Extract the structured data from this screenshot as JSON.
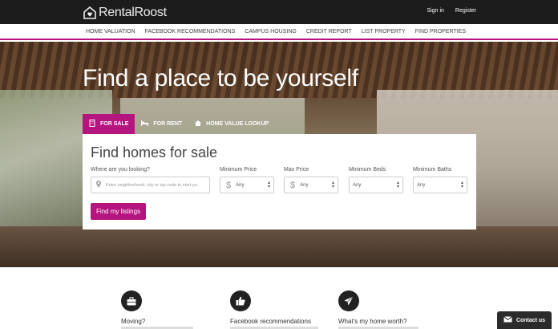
{
  "brand": {
    "name": "RentalRoost"
  },
  "header": {
    "links": [
      "Sign in",
      "Register"
    ]
  },
  "nav": {
    "items": [
      "HOME VALUATION",
      "FACEBOOK RECOMMENDATIONS",
      "CAMPUS HOUSING",
      "CREDIT REPORT",
      "LIST PROPERTY",
      "FIND PROPERTIES"
    ]
  },
  "hero": {
    "title": "Find a place to be yourself"
  },
  "tabs": [
    {
      "label": "FOR SALE",
      "icon": "building-icon"
    },
    {
      "label": "FOR RENT",
      "icon": "bed-icon"
    },
    {
      "label": "HOME VALUE LOOKUP",
      "icon": "home-icon"
    }
  ],
  "search": {
    "title": "Find homes for sale",
    "location": {
      "label": "Where are you looking?",
      "placeholder": "Enter neighborhood, city or zip code to start yo..."
    },
    "min_price": {
      "label": "Minimum Price",
      "value": "Any",
      "currency": "$"
    },
    "max_price": {
      "label": "Max Price",
      "value": "Any",
      "currency": "$"
    },
    "min_beds": {
      "label": "Minimum Beds",
      "value": "Any"
    },
    "min_baths": {
      "label": "Minimum Baths",
      "value": "Any"
    },
    "submit_label": "Find my listings"
  },
  "features": [
    {
      "title": "Moving?",
      "icon": "briefcase-icon"
    },
    {
      "title": "Facebook recommendations",
      "icon": "thumbs-up-icon"
    },
    {
      "title": "What's my home worth?",
      "icon": "paper-plane-icon"
    }
  ],
  "contact": {
    "label": "Contact us"
  },
  "colors": {
    "accent": "#b5157f",
    "topbar": "#1c1c1c"
  }
}
